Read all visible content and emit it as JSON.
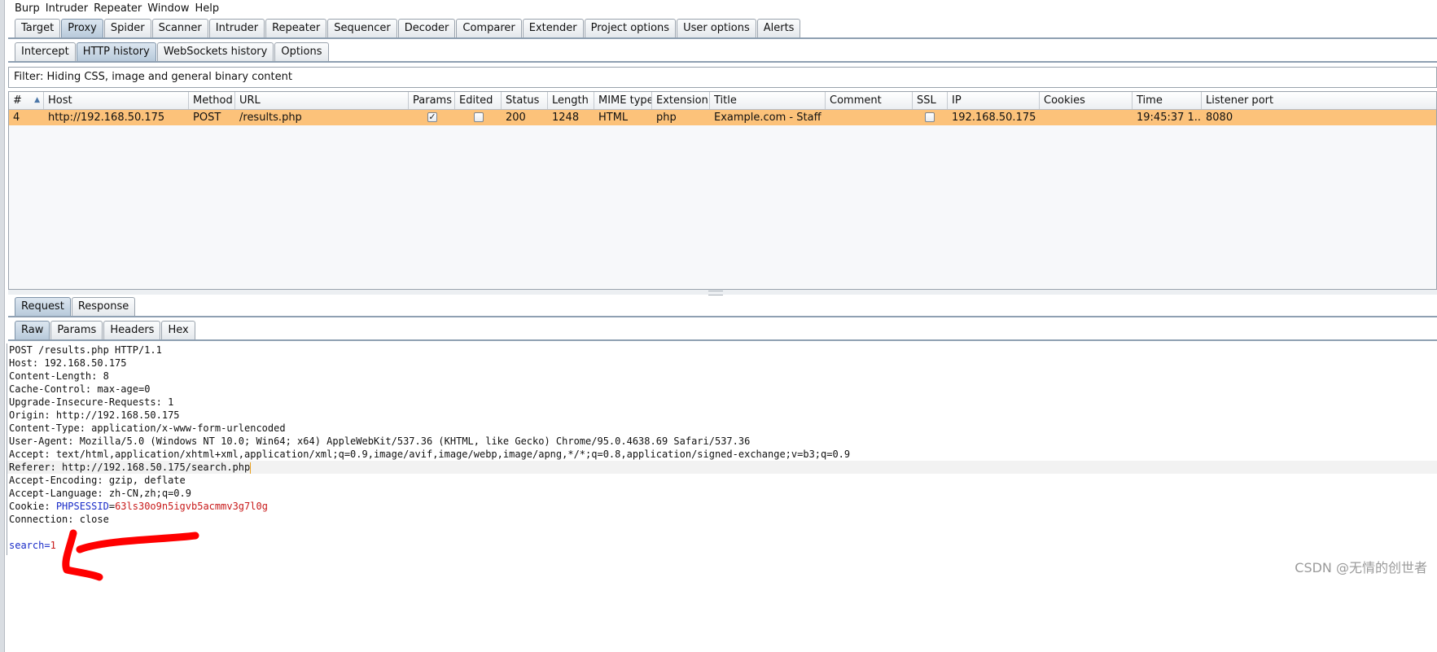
{
  "menu": [
    "Burp",
    "Intruder",
    "Repeater",
    "Window",
    "Help"
  ],
  "main_tabs": [
    {
      "label": "Target",
      "active": false
    },
    {
      "label": "Proxy",
      "active": true
    },
    {
      "label": "Spider",
      "active": false
    },
    {
      "label": "Scanner",
      "active": false
    },
    {
      "label": "Intruder",
      "active": false
    },
    {
      "label": "Repeater",
      "active": false
    },
    {
      "label": "Sequencer",
      "active": false
    },
    {
      "label": "Decoder",
      "active": false
    },
    {
      "label": "Comparer",
      "active": false
    },
    {
      "label": "Extender",
      "active": false
    },
    {
      "label": "Project options",
      "active": false
    },
    {
      "label": "User options",
      "active": false
    },
    {
      "label": "Alerts",
      "active": false
    }
  ],
  "proxy_tabs": [
    {
      "label": "Intercept",
      "active": false
    },
    {
      "label": "HTTP history",
      "active": true
    },
    {
      "label": "WebSockets history",
      "active": false
    },
    {
      "label": "Options",
      "active": false
    }
  ],
  "filter": {
    "text": "Filter: Hiding CSS, image and general binary content"
  },
  "history_table": {
    "columns": [
      "#",
      "Host",
      "Method",
      "URL",
      "Params",
      "Edited",
      "Status",
      "Length",
      "MIME type",
      "Extension",
      "Title",
      "Comment",
      "SSL",
      "IP",
      "Cookies",
      "Time",
      "Listener port"
    ],
    "sort_column": "#",
    "rows": [
      {
        "num": "4",
        "host": "http://192.168.50.175",
        "method": "POST",
        "url": "/results.php",
        "params": true,
        "edited": false,
        "status": "200",
        "length": "1248",
        "mime": "HTML",
        "extension": "php",
        "title": "Example.com - Staff ...",
        "comment": "",
        "ssl": false,
        "ip": "192.168.50.175",
        "cookies": "",
        "time": "19:45:37 1...",
        "listener": "8080"
      }
    ],
    "selected_row_color": "#fcc27a"
  },
  "message_tabs": [
    {
      "label": "Request",
      "active": true
    },
    {
      "label": "Response",
      "active": false
    }
  ],
  "view_tabs": [
    {
      "label": "Raw",
      "active": true
    },
    {
      "label": "Params",
      "active": false
    },
    {
      "label": "Headers",
      "active": false
    },
    {
      "label": "Hex",
      "active": false
    }
  ],
  "request": {
    "request_line": "POST /results.php HTTP/1.1",
    "headers": [
      {
        "name": "Host:",
        "value": "192.168.50.175"
      },
      {
        "name": "Content-Length:",
        "value": "8"
      },
      {
        "name": "Cache-Control:",
        "value": "max-age=0"
      },
      {
        "name": "Upgrade-Insecure-Requests:",
        "value": "1"
      },
      {
        "name": "Origin:",
        "value": "http://192.168.50.175"
      },
      {
        "name": "Content-Type:",
        "value": "application/x-www-form-urlencoded"
      },
      {
        "name": "User-Agent:",
        "value": "Mozilla/5.0 (Windows NT 10.0; Win64; x64) AppleWebKit/537.36 (KHTML, like Gecko) Chrome/95.0.4638.69 Safari/537.36"
      },
      {
        "name": "Accept:",
        "value": "text/html,application/xhtml+xml,application/xml;q=0.9,image/avif,image/webp,image/apng,*/*;q=0.8,application/signed-exchange;v=b3;q=0.9"
      },
      {
        "name": "Referer:",
        "value": "http://192.168.50.175/search.php"
      },
      {
        "name": "Accept-Encoding:",
        "value": "gzip, deflate"
      },
      {
        "name": "Accept-Language:",
        "value": "zh-CN,zh;q=0.9"
      }
    ],
    "cookie": {
      "name": "Cookie:",
      "param": "PHPSESSID",
      "eq": "=",
      "value": "63ls30o9n5igvb5acmmv3g7l0g"
    },
    "connection": {
      "name": "Connection:",
      "value": "close"
    },
    "body": {
      "param": "search",
      "eq": "=",
      "value": "1"
    }
  },
  "watermark": "CSDN @无情的创世者",
  "colors": {
    "annotation": "#ff0000",
    "cookie_param": "#1a2cc8",
    "cookie_value": "#c81a1a"
  }
}
